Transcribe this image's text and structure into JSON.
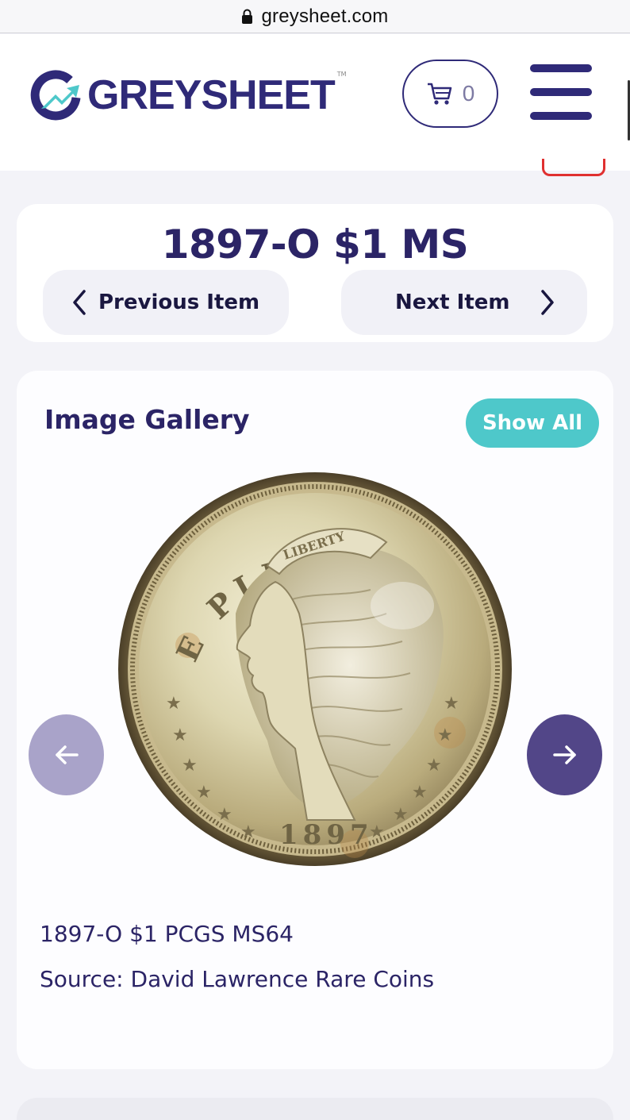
{
  "browser": {
    "url": "greysheet.com"
  },
  "header": {
    "logo_text": "GREYSHEET",
    "logo_tm": "TM",
    "cart_count": "0"
  },
  "item": {
    "title": "1897-O $1 MS",
    "prev_label": "Previous Item",
    "next_label": "Next Item"
  },
  "gallery": {
    "heading": "Image Gallery",
    "show_all_label": "Show All",
    "coin_legend": "E PLURIBUS UNUM",
    "coin_liberty": "LIBERTY",
    "coin_date": "1897",
    "caption": "1897-O $1 PCGS MS64",
    "source": "Source: David Lawrence Rare Coins"
  },
  "colors": {
    "brand_navy": "#2f2a78",
    "accent_teal": "#4ec8ca",
    "arrow_active": "#524688",
    "arrow_disabled": "#a9a3c9"
  }
}
